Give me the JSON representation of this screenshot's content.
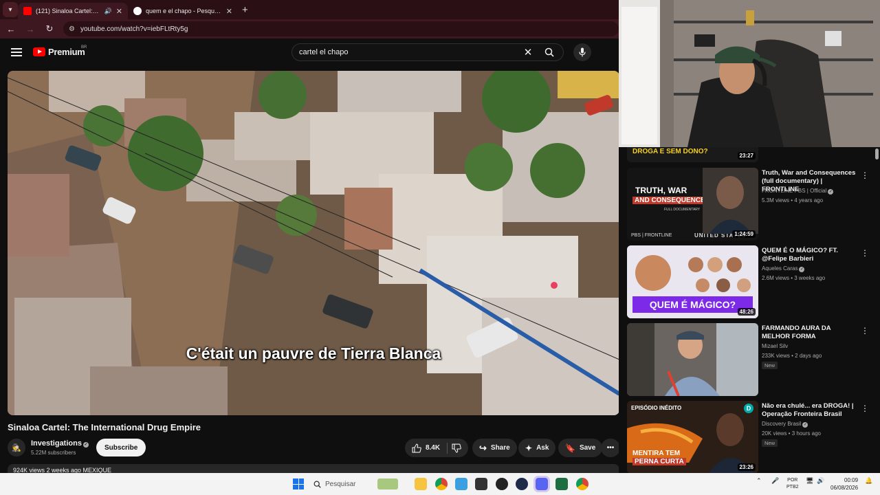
{
  "browser": {
    "tabs": [
      {
        "title": "(121) Sinaloa Cartel: The International Drug Empire",
        "active": true
      },
      {
        "title": "quem e el chapo - Pesquisa Google",
        "active": false
      }
    ],
    "url": "youtube.com/watch?v=iebFLtRty5g"
  },
  "youtube": {
    "logo_text": "Premium",
    "region": "BR",
    "search_value": "cartel el chapo",
    "search_placeholder": "Pesquisar"
  },
  "video": {
    "subtitle": "C'était un pauvre de Tierra Blanca",
    "title": "Sinaloa Cartel: The International Drug Empire",
    "channel": "Investigations",
    "subscribers": "5.22M subscribers",
    "subscribe_label": "Subscribe",
    "likes": "8.4K",
    "share_label": "Share",
    "ask_label": "Ask",
    "save_label": "Save",
    "meta_peek": "924K views  2 weeks ago  MEXIQUE"
  },
  "sidebar": {
    "partial_top": {
      "overlay_text": "DROGA E SEM DONO?",
      "duration": "23:27"
    },
    "items": [
      {
        "title": "Truth, War and Consequences (full documentary) | FRONTLINE",
        "channel": "FRONTLINE PBS | Official",
        "stats": "5.3M views • 4 years ago",
        "duration": "1:24:59",
        "thumb_text_1": "TRUTH, WAR",
        "thumb_text_2": "AND CONSEQUENCES",
        "thumb_text_3": "PBS | FRONTLINE",
        "thumb_text_4": "FULL DOCUMENTARY",
        "thumb_text_5": "UNITED STATES",
        "badge": ""
      },
      {
        "title": "QUEM É O MÁGICO? FT. @Felipe Barbieri",
        "channel": "Aqueles Caras",
        "stats": "2.6M views • 3 weeks ago",
        "duration": "48:26",
        "thumb_text_1": "QUEM É MÁGICO?",
        "badge": ""
      },
      {
        "title": "FARMANDO AURA DA MELHOR FORMA",
        "channel": "Mizael Silv",
        "stats": "233K views • 2 days ago",
        "duration": "",
        "badge": "New"
      },
      {
        "title": "Não era chulé... era DROGA! | Operação Fronteira Brasil",
        "channel": "Discovery Brasil",
        "stats": "20K views • 3 hours ago",
        "duration": "23:26",
        "thumb_text_1": "EPISÓDIO INÉDITO",
        "thumb_text_2": "MENTIRA TEM",
        "thumb_text_3": "PERNA CURTA",
        "badge": "New"
      }
    ]
  },
  "taskbar": {
    "search_label": "Pesquisar",
    "lang_1": "POR",
    "lang_2": "PTB2",
    "time": "00:09",
    "date": "06/08/2026"
  },
  "colors": {
    "youtube_red": "#ff0000",
    "tab_bar": "#2a0f14",
    "background": "#0f0f0f"
  }
}
